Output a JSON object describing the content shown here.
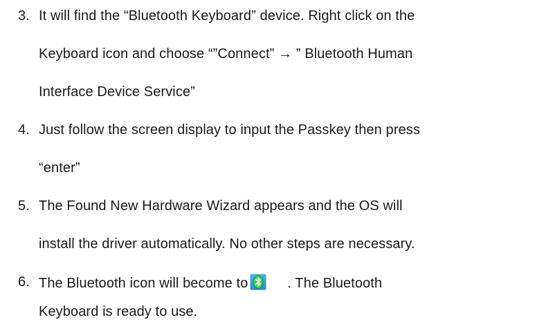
{
  "steps": [
    {
      "number": "3.",
      "lines": [
        "It will find the “Bluetooth Keyboard” device. Right click on the",
        "Keyboard icon and choose “”Connect”  →  ” Bluetooth Human",
        "Interface Device Service”"
      ]
    },
    {
      "number": "4.",
      "lines": [
        "Just follow the screen display to input the Passkey then press",
        "“enter”"
      ]
    },
    {
      "number": "5.",
      "lines": [
        "The Found New Hardware Wizard appears and the OS will",
        "install the driver automatically. No other steps are necessary."
      ]
    },
    {
      "number": "6.",
      "line1_before_icon": "The Bluetooth icon will become to",
      "line1_after_icon": ". The Bluetooth",
      "lines": [
        "Keyboard is ready to use."
      ],
      "icon": "bluetooth-tray-icon",
      "icon_colors": {
        "background": "#1f8ed8",
        "symbol": "#3bd24f"
      }
    }
  ]
}
